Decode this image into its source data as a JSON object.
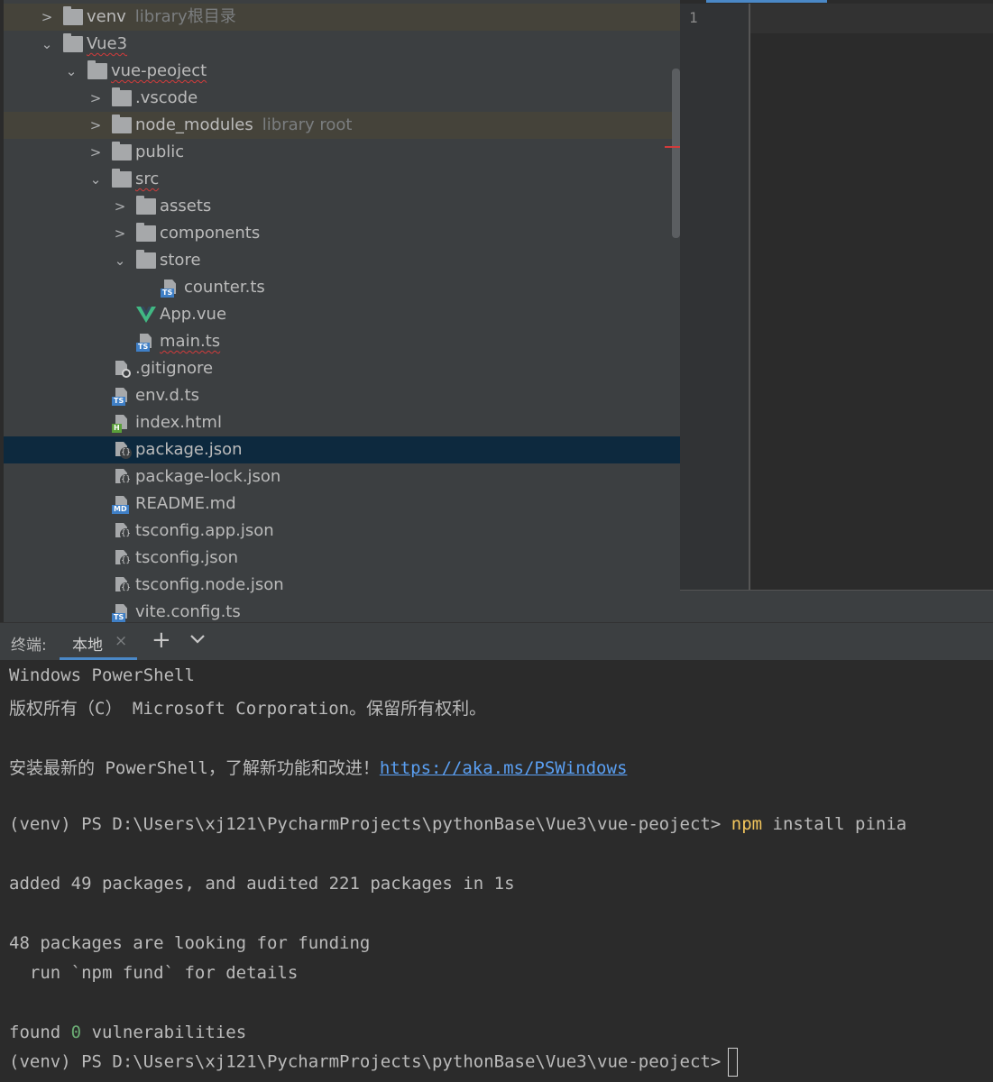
{
  "tree": {
    "rows": [
      {
        "label": "venv",
        "hint": "library根目录",
        "kind": "folder",
        "expanded": false
      },
      {
        "label": "Vue3",
        "kind": "folder",
        "expanded": true
      },
      {
        "label": "vue-peoject",
        "kind": "folder",
        "expanded": true
      },
      {
        "label": ".vscode",
        "kind": "folder",
        "expanded": false
      },
      {
        "label": "node_modules",
        "hint": "library root",
        "kind": "folder",
        "expanded": false
      },
      {
        "label": "public",
        "kind": "folder",
        "expanded": false
      },
      {
        "label": "src",
        "kind": "folder",
        "expanded": true
      },
      {
        "label": "assets",
        "kind": "folder",
        "expanded": false
      },
      {
        "label": "components",
        "kind": "folder",
        "expanded": false
      },
      {
        "label": "store",
        "kind": "folder",
        "expanded": true
      },
      {
        "label": "counter.ts",
        "kind": "ts-file"
      },
      {
        "label": "App.vue",
        "kind": "vue-file"
      },
      {
        "label": "main.ts",
        "kind": "ts-file"
      },
      {
        "label": ".gitignore",
        "kind": "ignore-file"
      },
      {
        "label": "env.d.ts",
        "kind": "ts-file"
      },
      {
        "label": "index.html",
        "kind": "html-file"
      },
      {
        "label": "package.json",
        "kind": "json-file",
        "selected": true
      },
      {
        "label": "package-lock.json",
        "kind": "json-file"
      },
      {
        "label": "README.md",
        "kind": "md-file"
      },
      {
        "label": "tsconfig.app.json",
        "kind": "json-file"
      },
      {
        "label": "tsconfig.json",
        "kind": "json-file"
      },
      {
        "label": "tsconfig.node.json",
        "kind": "json-file"
      },
      {
        "label": "vite.config.ts",
        "kind": "ts-file"
      }
    ],
    "icon_tags": {
      "ts": "TS",
      "md": "MD",
      "html": "H",
      "json": "{}"
    }
  },
  "editor": {
    "line_numbers": [
      "1"
    ]
  },
  "terminal": {
    "title": "终端:",
    "tab_label": "本地",
    "close_icon": "×",
    "add_icon": "+",
    "menu_icon": "⌄",
    "lines": {
      "l1": "Windows PowerShell",
      "l2": "版权所有（C） Microsoft Corporation。保留所有权利。",
      "l3_prefix": "安装最新的 PowerShell，了解新功能和改进！",
      "l3_link": "https://aka.ms/PSWindows",
      "prompt": "(venv) PS D:\\Users\\xj121\\PycharmProjects\\pythonBase\\Vue3\\vue-peoject>",
      "cmd_npm": "npm",
      "cmd_rest": "install pinia",
      "added": "added 49 packages, and audited 221 packages in 1s",
      "funding": "48 packages are looking for funding",
      "fund_hint": "  run `npm fund` for details",
      "found_prefix": "found",
      "found_count": "0",
      "found_suffix": "vulnerabilities"
    }
  },
  "colors": {
    "selection": "#0d293e",
    "library_row": "#45433a",
    "accent": "#4a88c7",
    "command": "#f2c55c",
    "link": "#5a9ff2"
  }
}
